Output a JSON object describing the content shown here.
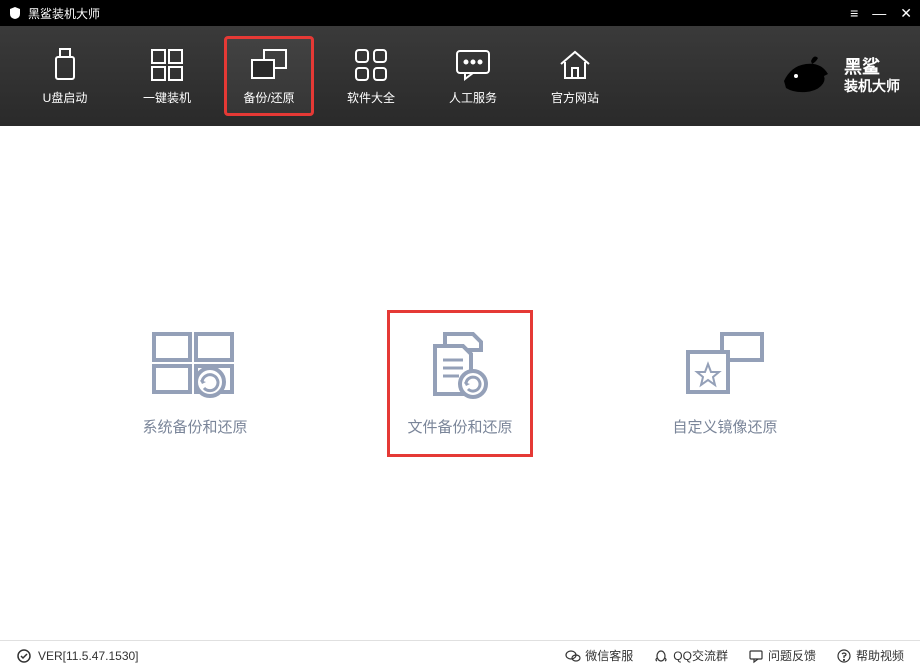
{
  "app": {
    "title": "黑鲨装机大师"
  },
  "toolbar": {
    "items": [
      {
        "label": "U盘启动"
      },
      {
        "label": "一键装机"
      },
      {
        "label": "备份/还原"
      },
      {
        "label": "软件大全"
      },
      {
        "label": "人工服务"
      },
      {
        "label": "官方网站"
      }
    ],
    "logo_line1": "黑鲨",
    "logo_line2": "装机大师"
  },
  "main": {
    "options": [
      {
        "label": "系统备份和还原"
      },
      {
        "label": "文件备份和还原"
      },
      {
        "label": "自定义镜像还原"
      }
    ]
  },
  "status": {
    "version": "VER[11.5.47.1530]",
    "items": [
      {
        "label": "微信客服"
      },
      {
        "label": "QQ交流群"
      },
      {
        "label": "问题反馈"
      },
      {
        "label": "帮助视频"
      }
    ]
  }
}
